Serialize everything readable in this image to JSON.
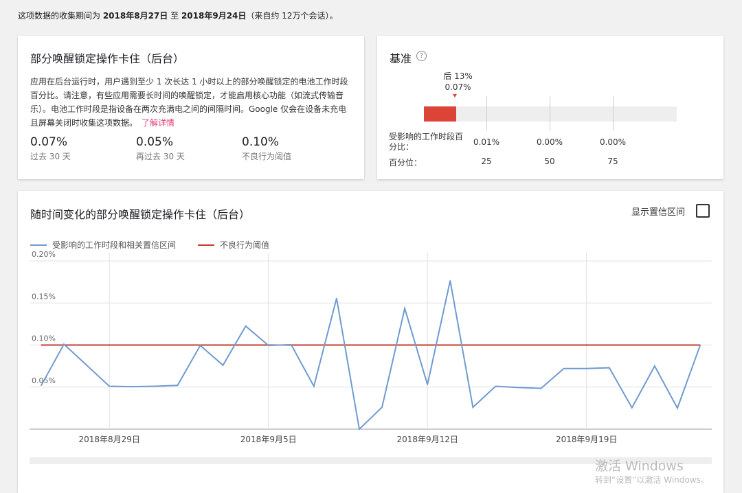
{
  "header": {
    "prefix": "这项数据的收集期间为 ",
    "start_date": "2018年8月27日",
    "mid": "至",
    "end_date": "2018年9月24日",
    "suffix": "（来自约 12万个会话）。"
  },
  "summary_card": {
    "title": "部分唤醒锁定操作卡住（后台）",
    "description": "应用在后台运行时，用户遇到至少 1 次长达 1 小时以上的部分唤醒锁定的电池工作时段百分比。请注意，有些应用需要长时间的唤醒锁定，才能启用核心功能（如流式传输音乐）。电池工作时段是指设备在两次充满电之间的间隔时间。Google 仅会在设备未充电且屏幕关闭时收集这项数据。",
    "learn_more": "了解详情",
    "metrics": [
      {
        "value": "0.07%",
        "label": "过去 30 天"
      },
      {
        "value": "0.05%",
        "label": "再过去 30 天"
      },
      {
        "value": "0.10%",
        "label": "不良行为阈值"
      }
    ]
  },
  "benchmark_card": {
    "title": "基准",
    "help_icon": "question-circle-icon",
    "marker_label": "后 13%",
    "marker_value": "0.07%",
    "bar_fill_fraction": 0.13,
    "row1_label": "受影响的工作时段百分比：",
    "row2_label": "百分位：",
    "columns": [
      {
        "percent": "0.01%",
        "percentile": "25"
      },
      {
        "percent": "0.00%",
        "percentile": "50"
      },
      {
        "percent": "0.00%",
        "percentile": "75"
      }
    ]
  },
  "trend_card": {
    "title": "随时间变化的部分唤醒锁定操作卡住（后台）",
    "toggle_label": "显示置信区间",
    "toggle_checked": false
  },
  "chart_data": {
    "type": "line",
    "series": [
      {
        "name": "受影响的工作时段和相关置信区间",
        "color": "#6f9bd1",
        "values": [
          0.052,
          0.101,
          0.076,
          0.051,
          0.0505,
          0.051,
          0.052,
          0.0995,
          0.076,
          0.1225,
          0.0995,
          0.1005,
          0.051,
          0.1555,
          0.0,
          0.026,
          0.1435,
          0.053,
          0.1765,
          0.026,
          0.051,
          0.0495,
          0.0485,
          0.072,
          0.072,
          0.073,
          0.0255,
          0.075,
          0.025,
          0.0995
        ]
      },
      {
        "name": "不良行为阈值",
        "color": "#c53929",
        "values": [
          0.1,
          0.1,
          0.1,
          0.1,
          0.1,
          0.1,
          0.1,
          0.1,
          0.1,
          0.1,
          0.1,
          0.1,
          0.1,
          0.1,
          0.1,
          0.1,
          0.1,
          0.1,
          0.1,
          0.1,
          0.1,
          0.1,
          0.1,
          0.1,
          0.1,
          0.1,
          0.1,
          0.1,
          0.1,
          0.1
        ]
      }
    ],
    "x_start_day": 0,
    "x_labels": [
      {
        "day": 3,
        "label": "2018年8月29日"
      },
      {
        "day": 10,
        "label": "2018年9月5日"
      },
      {
        "day": 17,
        "label": "2018年9月12日"
      },
      {
        "day": 24,
        "label": "2018年9月19日"
      }
    ],
    "y_ticks": [
      {
        "value": 0.2,
        "label": "0.20%"
      },
      {
        "value": 0.15,
        "label": "0.15%"
      },
      {
        "value": 0.1,
        "label": "0.10%"
      },
      {
        "value": 0.05,
        "label": "0.05%"
      }
    ],
    "ylim": [
      0,
      0.2
    ],
    "grid": true,
    "legend_position": "top-left"
  },
  "watermark": {
    "line1": "激活 Windows",
    "line2": "转到“设置”以激活 Windows。"
  }
}
